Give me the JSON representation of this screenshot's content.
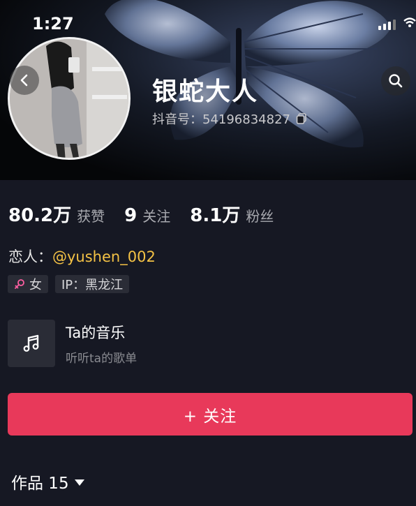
{
  "status_bar": {
    "time": "1:27"
  },
  "header": {
    "nickname": "银蛇大人",
    "douyin_id": "抖音号：54196834827",
    "back_icon": "chevron-left-icon",
    "search_icon": "search-icon",
    "copy_icon": "copy-icon"
  },
  "stats": [
    {
      "value": "80.2万",
      "label": "获赞"
    },
    {
      "value": "9",
      "label": "关注"
    },
    {
      "value": "8.1万",
      "label": "粉丝"
    }
  ],
  "lover": {
    "prefix": "恋人：",
    "handle": "@yushen_002"
  },
  "tags": [
    {
      "icon": "female-icon",
      "text": "女"
    },
    {
      "text": "IP：黑龙江"
    }
  ],
  "music": {
    "title": "Ta的音乐",
    "subtitle": "听听ta的歌单",
    "icon": "music-note-icon"
  },
  "follow_button": {
    "label": "+ 关注"
  },
  "works_tab": {
    "label": "作品 15"
  },
  "colors": {
    "background": "#161823",
    "accent": "#e8395a",
    "handle": "#f4c245"
  }
}
